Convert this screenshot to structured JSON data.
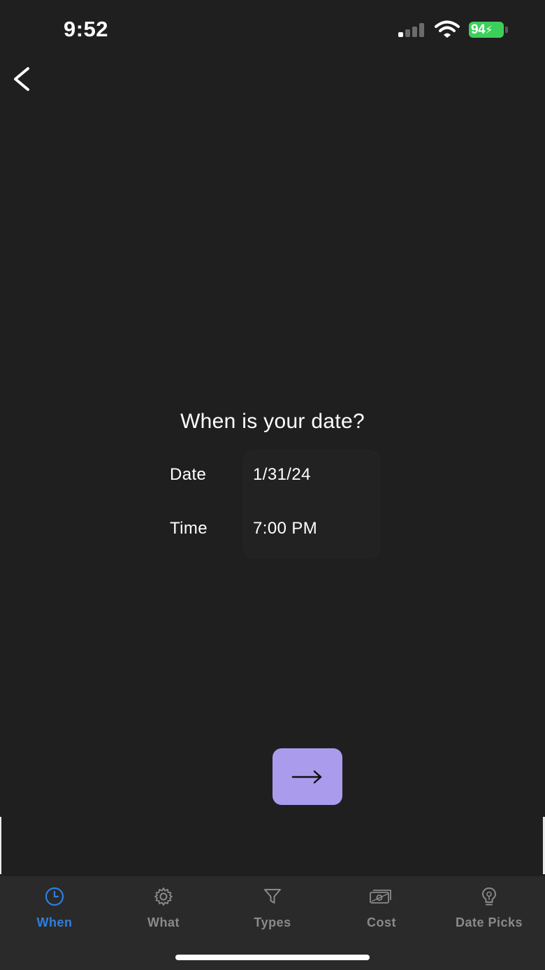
{
  "status_bar": {
    "time": "9:52",
    "battery_percent": "94",
    "battery_color": "#3ccf5a",
    "signal_bars_filled": 1,
    "signal_bars_total": 4
  },
  "nav": {
    "back_icon": "chevron-left-icon"
  },
  "main": {
    "question": "When is your date?",
    "date_label": "Date",
    "date_value": "1/31/24",
    "time_label": "Time",
    "time_value": "7:00 PM",
    "next_icon": "arrow-right-icon",
    "next_button_color": "#ab9bec"
  },
  "tab_bar": {
    "active_color": "#2f7fe0",
    "inactive_color": "#8a8a8c",
    "tabs": [
      {
        "label": "When",
        "icon": "clock-icon",
        "active": true
      },
      {
        "label": "What",
        "icon": "gear-icon",
        "active": false
      },
      {
        "label": "Types",
        "icon": "filter-icon",
        "active": false
      },
      {
        "label": "Cost",
        "icon": "money-icon",
        "active": false
      },
      {
        "label": "Date Picks",
        "icon": "lightbulb-icon",
        "active": false
      }
    ]
  }
}
